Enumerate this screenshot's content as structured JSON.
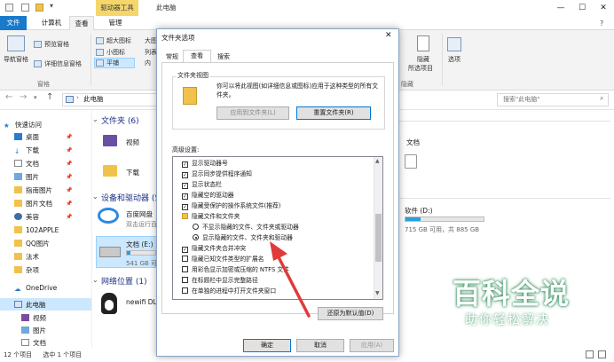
{
  "window": {
    "title": "此电脑",
    "context_tab": "驱动器工具",
    "min": "—",
    "max": "☐",
    "close": "✕"
  },
  "ribbon_tabs": [
    "文件",
    "计算机",
    "查看",
    "管理"
  ],
  "ribbon": {
    "nav_pane": "导航窗格",
    "preview_pane": "预览窗格",
    "details_pane": "详细信息窗格",
    "pane_group": "窗格",
    "layout_items": [
      "超大图标",
      "大图",
      "小图标",
      "列表",
      "平铺",
      "内"
    ],
    "hide_selected": "隐藏",
    "hide_selected2": "所选项目",
    "options": "选项",
    "show_hide_group": "隐藏"
  },
  "address": {
    "path": "此电脑",
    "search_placeholder": "搜索\"此电脑\""
  },
  "nav_pane": {
    "quick_access": "快速访问",
    "items": [
      "桌面",
      "下载",
      "文档",
      "图片",
      "指南图片",
      "图片文档",
      "美容",
      "102APPLE",
      "QQ图片",
      "法术",
      "杂项"
    ],
    "onedrive": "OneDrive",
    "this_pc": "此电脑",
    "pc_items": [
      "视频",
      "图片",
      "文档"
    ]
  },
  "content": {
    "folders_header": "文件夹 (6)",
    "folders": [
      "视频",
      "下载"
    ],
    "right_folder": "文档",
    "drives_header": "设备和驱动器 (5",
    "baidu_name": "百度网盘",
    "baidu_sub": "双击运行百度网",
    "drive_e_name": "文档 (E:)",
    "drive_e_size": "541 GB 可",
    "drive_d_name": "软件 (D:)",
    "drive_d_size": "715 GB 可用，共 885 GB",
    "drive_d_fill": 0.19,
    "drive_e_fill": 0.12,
    "network_header": "网络位置 (1)",
    "network_item": "newifi DL"
  },
  "status": {
    "count": "12 个项目",
    "selected": "选中 1 个项目"
  },
  "dialog": {
    "title": "文件夹选项",
    "close": "✕",
    "tabs": [
      "常规",
      "查看",
      "搜索"
    ],
    "folder_views_label": "文件夹视图",
    "folder_views_desc": "你可以将此视图(如详细信息或图标)应用于这种类型的所有文件夹。",
    "apply_btn": "应用到文件夹(L)",
    "reset_btn": "重置文件夹(R)",
    "advanced_label": "高级设置:",
    "tree": [
      {
        "kind": "cb",
        "checked": true,
        "text": "显示驱动器号"
      },
      {
        "kind": "cb",
        "checked": true,
        "text": "显示同步提供程序通知"
      },
      {
        "kind": "cb",
        "checked": true,
        "text": "显示状态栏"
      },
      {
        "kind": "cb",
        "checked": true,
        "text": "隐藏空的驱动器"
      },
      {
        "kind": "cb",
        "checked": true,
        "text": "隐藏受保护的操作系统文件(推荐)"
      },
      {
        "kind": "folder",
        "text": "隐藏文件和文件夹"
      },
      {
        "kind": "rb",
        "checked": false,
        "text": "不显示隐藏的文件、文件夹或驱动器"
      },
      {
        "kind": "rb",
        "checked": true,
        "text": "显示隐藏的文件、文件夹和驱动器"
      },
      {
        "kind": "cb",
        "checked": true,
        "text": "隐藏文件夹合并冲突"
      },
      {
        "kind": "cb",
        "checked": false,
        "text": "隐藏已知文件类型的扩展名"
      },
      {
        "kind": "cb",
        "checked": false,
        "text": "用彩色显示加密或压缩的 NTFS 文件"
      },
      {
        "kind": "cb",
        "checked": false,
        "text": "在标题栏中显示完整路径"
      },
      {
        "kind": "cb",
        "checked": false,
        "text": "在单独的进程中打开文件夹窗口"
      }
    ],
    "restore_btn": "还原为默认值(D)",
    "ok_btn": "确定",
    "cancel_btn": "取消",
    "apply2_btn": "应用(A)"
  },
  "watermark": {
    "big": "百科全说",
    "small": "助你轻松解决"
  },
  "colors": {
    "file_tab": "#1979ca",
    "context_tab": "#f5d66b",
    "drive_bar": "#26a0da",
    "arrow": "#e03a3a",
    "select": "#cce8ff"
  }
}
